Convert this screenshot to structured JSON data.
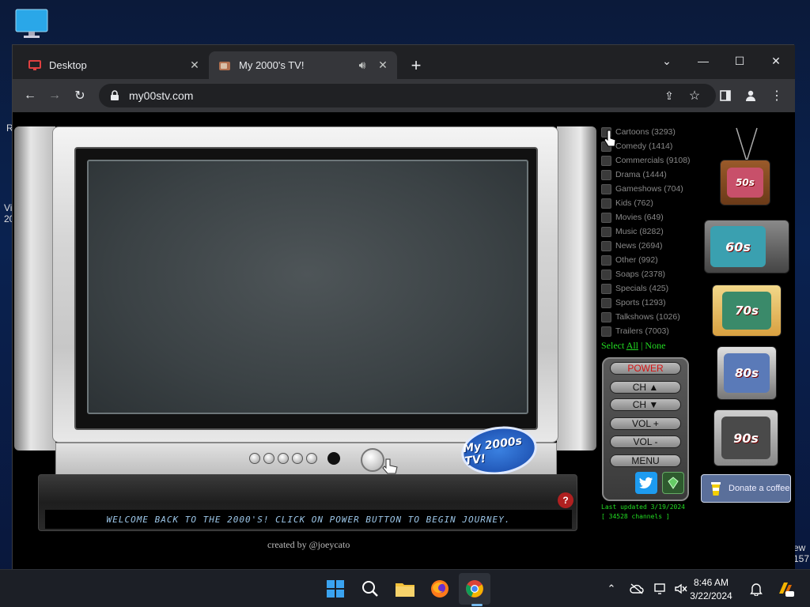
{
  "desktop": {
    "edge_text_left_top": "R",
    "edge_text_left_mid": "Vi\n20",
    "edge_text_right_bottom": "ew\n157"
  },
  "browser": {
    "tabs": [
      {
        "label": "Desktop",
        "icon": "monitor-icon",
        "active": false
      },
      {
        "label": "My 2000's TV!",
        "icon": "tv-favicon-icon",
        "active": true,
        "audio": true
      }
    ],
    "url": "my00stv.com"
  },
  "page": {
    "marquee": "WELCOME BACK TO THE 2000'S! CLICK ON POWER BUTTON TO BEGIN JOURNEY.",
    "credit": "created by @joeycato",
    "logo_text": "My 2000s TV!",
    "help_label": "?",
    "channels": [
      {
        "label": "Cartoons (3293)"
      },
      {
        "label": "Comedy (1414)"
      },
      {
        "label": "Commercials (9108)"
      },
      {
        "label": "Drama (1444)"
      },
      {
        "label": "Gameshows (704)"
      },
      {
        "label": "Kids (762)"
      },
      {
        "label": "Movies (649)"
      },
      {
        "label": "Music (8282)"
      },
      {
        "label": "News (2694)"
      },
      {
        "label": "Other (992)"
      },
      {
        "label": "Soaps (2378)"
      },
      {
        "label": "Specials (425)"
      },
      {
        "label": "Sports (1293)"
      },
      {
        "label": "Talkshows (1026)"
      },
      {
        "label": "Trailers (7003)"
      }
    ],
    "select_prefix": "Select ",
    "select_all": "All",
    "select_sep": " | ",
    "select_none": "None",
    "remote": {
      "power": "POWER",
      "ch_up": "CH ▲",
      "ch_down": "CH ▼",
      "vol_up": "VOL +",
      "vol_down": "VOL -",
      "menu": "MENU"
    },
    "last_updated": "Last updated 3/19/2024",
    "channel_count": "[ 34528 channels ]",
    "decades": [
      {
        "label": "50s"
      },
      {
        "label": "60s"
      },
      {
        "label": "70s"
      },
      {
        "label": "80s"
      },
      {
        "label": "90s"
      }
    ],
    "donate": "Donate a coffee"
  },
  "taskbar": {
    "time": "8:46 AM",
    "date": "3/22/2024"
  },
  "colors": {
    "accent_green": "#22dd22",
    "power_red": "#d41414",
    "twitter_blue": "#1d9bf0"
  }
}
